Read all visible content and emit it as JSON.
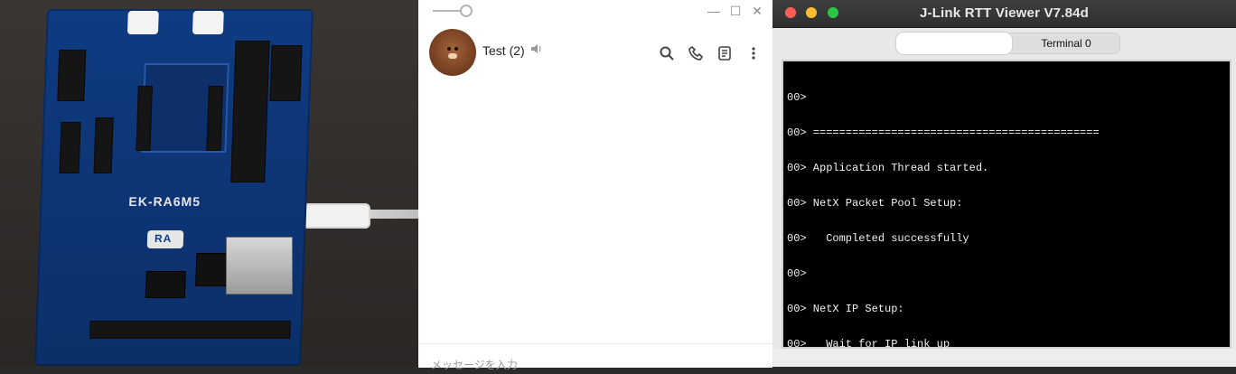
{
  "photo": {
    "board_label": "EK-RA6M5",
    "board_brand": "RA"
  },
  "chat": {
    "window_controls": {
      "minimize": "—",
      "maximize": "☐",
      "close": "✕"
    },
    "contact_name": "Test (2)",
    "header_icons": [
      "search-icon",
      "phone-icon",
      "notes-icon",
      "more-icon"
    ],
    "input_placeholder": "メッセージを入力",
    "colors": {
      "background": "#ffffff",
      "avatar_brown": "#7b4424"
    }
  },
  "jlink": {
    "window_title": "J-Link RTT Viewer V7.84d",
    "tabs": {
      "terminal_label": "Terminal 0"
    },
    "terminal_lines": [
      "00>",
      "00> ============================================",
      "00> Application Thread started.",
      "00> NetX Packet Pool Setup:",
      "00>   Completed successfully",
      "00>",
      "00> NetX IP Setup:",
      "00>   Wait for IP link up"
    ],
    "colors": {
      "close": "#ff5f57",
      "minimize": "#febc2e",
      "zoom": "#28c840",
      "terminal_bg": "#000000",
      "terminal_fg": "#f2f2f2"
    }
  }
}
